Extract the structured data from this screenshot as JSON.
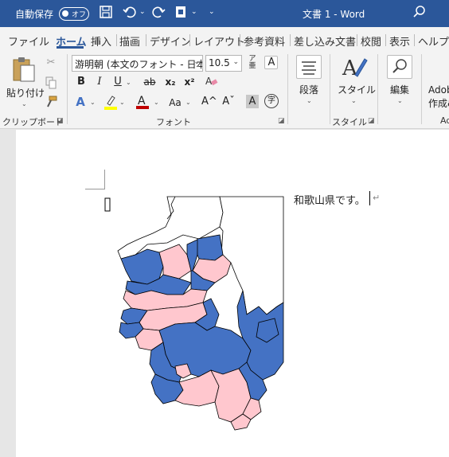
{
  "titlebar": {
    "autosave_label": "自動保存",
    "autosave_state": "オフ",
    "document_title": "文書 1  -  Word"
  },
  "tabs": [
    "ファイル",
    "ホーム",
    "挿入",
    "描画",
    "デザイン",
    "レイアウト",
    "参考資料",
    "差し込み文書",
    "校閲",
    "表示",
    "ヘルプ"
  ],
  "active_tab": "ホーム",
  "ribbon": {
    "clipboard": {
      "paste_label": "貼り付け",
      "group_label": "クリップボード"
    },
    "font": {
      "font_name": "游明朝 (本文のフォント - 日本",
      "font_size": "10.5",
      "group_label": "フォント",
      "bold": "B",
      "italic": "I",
      "underline": "U",
      "strike": "ab",
      "subscript": "x₂",
      "superscript": "x²",
      "change_case": "Aa",
      "grow": "A^",
      "shrink": "Aˇ",
      "shading": "A",
      "enclose": "字",
      "box": "A",
      "font_color_accent": "#c00000",
      "highlight_accent": "#ffff00"
    },
    "paragraph": {
      "label": "段落"
    },
    "styles": {
      "label": "スタイル",
      "group_label": "スタイル"
    },
    "editing": {
      "label": "編集"
    },
    "adobe": {
      "line1": "Adob",
      "line2": "作成&",
      "group_partial": "Ad"
    }
  },
  "document": {
    "body_text": "和歌山県です。"
  },
  "map": {
    "colors": {
      "blue": "#4472c4",
      "pink": "#ffc7ce",
      "outline": "#000000"
    }
  }
}
